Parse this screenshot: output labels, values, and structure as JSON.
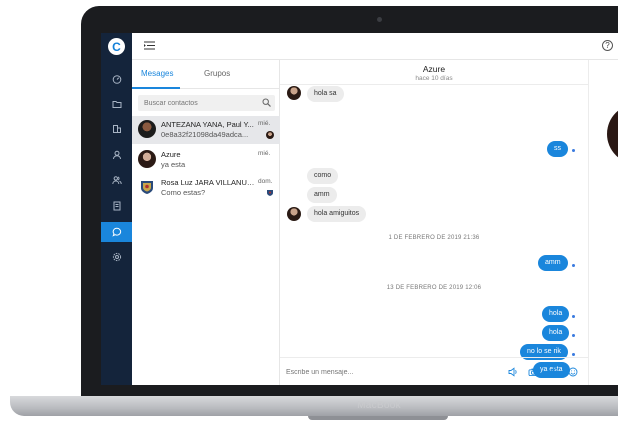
{
  "device": {
    "brand": "MacBook"
  },
  "rail": {
    "logo_letter": "C",
    "icons": [
      "dashboard-icon",
      "folder-icon",
      "building-icon",
      "user-icon",
      "users-icon",
      "document-icon",
      "chat-icon",
      "settings-icon"
    ],
    "active": "chat-icon"
  },
  "topbar": {
    "help_symbol": "?"
  },
  "tabs": [
    {
      "label": "Mesages",
      "active": true
    },
    {
      "label": "Grupos",
      "active": false
    }
  ],
  "search": {
    "placeholder": "Buscar contactos"
  },
  "conversations": [
    {
      "name": "ANTEZANA YANA, Paul Y...",
      "preview": "0e8a32f21098da49adca...",
      "date": "mié.",
      "selected": true
    },
    {
      "name": "Azure",
      "preview": "ya esta",
      "date": "mié.",
      "selected": false
    },
    {
      "name": "Rosa Luz JARA VILLANUE...",
      "preview": "Como estas?",
      "date": "dom.",
      "selected": false
    }
  ],
  "chat": {
    "title": "Azure",
    "subtitle": "hace 10 días",
    "messages": [
      {
        "text": "hola sa",
        "dir": "in"
      },
      {
        "text": "ss",
        "dir": "out"
      },
      {
        "text": "como",
        "dir": "in"
      },
      {
        "text": "amm",
        "dir": "in"
      },
      {
        "text": "hola amiguitos",
        "dir": "in"
      },
      {
        "text": "amm",
        "dir": "out"
      },
      {
        "text": "hola",
        "dir": "out"
      },
      {
        "text": "hola",
        "dir": "out"
      },
      {
        "text": "no lo se rik",
        "dir": "out"
      },
      {
        "text": "ya esta",
        "dir": "out"
      }
    ],
    "date_separators": [
      "1 DE FEBRERO DE 2019 21:36",
      "13 DE FEBRERO DE 2019 12:06"
    ],
    "composer_placeholder": "Escribe un mensaje...",
    "accent": "#1a86dc"
  }
}
